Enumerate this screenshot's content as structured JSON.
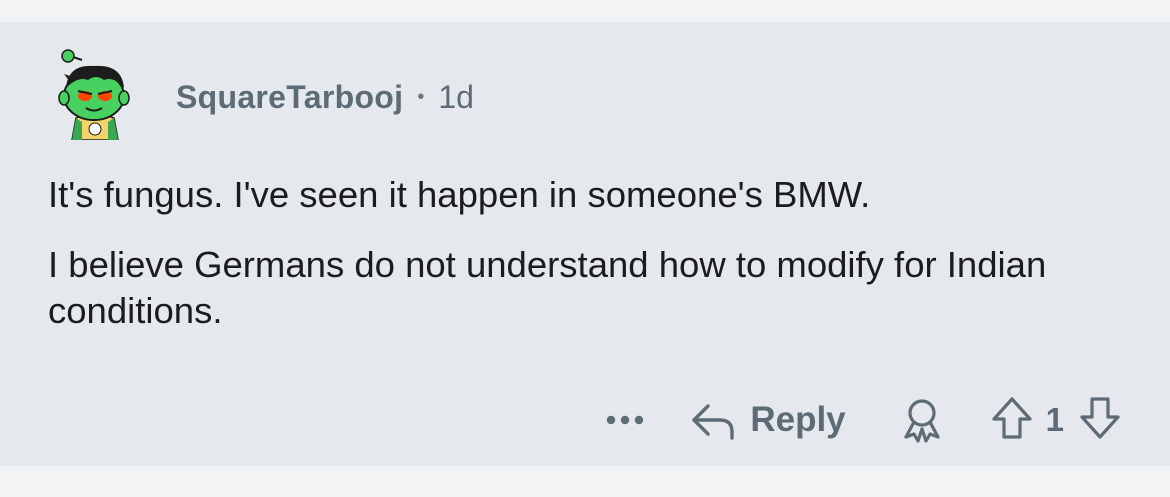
{
  "comment": {
    "author": "SquareTarbooj",
    "separator": "•",
    "age": "1d",
    "paragraphs": [
      "It's fungus. I've seen it happen in someone's BMW.",
      "I believe Germans do not understand how to modify for Indian conditions."
    ]
  },
  "actions": {
    "more_icon": "ellipsis-icon",
    "reply_icon": "reply-arrow-icon",
    "reply_label": "Reply",
    "award_icon": "award-icon",
    "upvote_icon": "upvote-arrow-icon",
    "score": "1",
    "downvote_icon": "downvote-arrow-icon"
  },
  "colors": {
    "card_bg": "#e5e9ed",
    "page_bg": "#f2f3f5",
    "meta_text": "#5c6b76",
    "body_text": "#1a1c1e",
    "avatar_green": "#46d160"
  }
}
